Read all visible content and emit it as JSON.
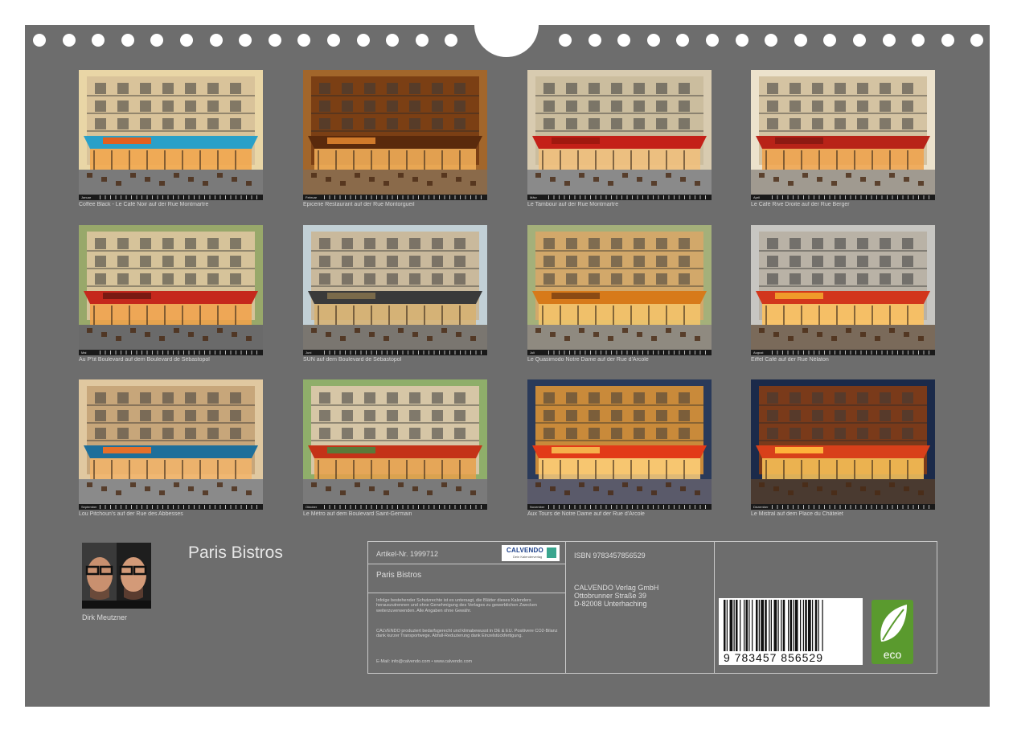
{
  "calendar": {
    "title": "Paris Bistros",
    "author": "Dirk Meutzner"
  },
  "months": [
    {
      "month": "Januar",
      "caption": "Coffee Black - Le Café Noir auf der Rue Montmartre",
      "scene": "noir"
    },
    {
      "month": "Februar",
      "caption": "Epicerie Restaurant auf der Rue Montorgueil",
      "scene": "epicerie"
    },
    {
      "month": "März",
      "caption": "Le Tambour auf der Rue Montmartre",
      "scene": "tambour"
    },
    {
      "month": "April",
      "caption": "Le Café Rive Droite auf der Rue Berger",
      "scene": "rivedroite"
    },
    {
      "month": "Mai",
      "caption": "Au P'tit Boulevard auf dem Boulevard de Sébastopol",
      "scene": "ptit"
    },
    {
      "month": "Juni",
      "caption": "SUN auf dem Boulevard de Sébastopol",
      "scene": "sun"
    },
    {
      "month": "Juli",
      "caption": "Le Quasimodo Notre Dame auf der Rue d'Arcole",
      "scene": "quasimodo"
    },
    {
      "month": "August",
      "caption": "Eiffel Café auf der Rue Nélaton",
      "scene": "eiffel"
    },
    {
      "month": "September",
      "caption": "Lou Pitchoun's auf der Rue des Abbesses",
      "scene": "pitchoun"
    },
    {
      "month": "Oktober",
      "caption": "Le Métro auf dem Boulevard Saint-Germain",
      "scene": "metro"
    },
    {
      "month": "November",
      "caption": "Aux Tours de Notre Dame auf der Rue d'Arcole",
      "scene": "tours"
    },
    {
      "month": "Dezember",
      "caption": "Le Mistral auf dem Place du Châtelet",
      "scene": "mistral"
    }
  ],
  "info": {
    "article": "Artikel-Nr. 1999712",
    "logo_word": "CALVENDO",
    "logo_sub": "Dein Kalenderverlag",
    "title": "Paris Bistros",
    "legal_1": "Infolge bestehender Schutzrechte ist es untersagt, die Blätter dieses Kalenders herauszutrennen und ohne Genehmigung des Verlages zu gewerblichen Zwecken weiterzuverwenden. Alle Angaben ohne Gewähr.",
    "legal_2": "CALVENDO produziert bedarfsgerecht und klimabewusst in DE & EU. Positivere CO2-Bilanz dank kurzer Transportwege. Abfall-Reduzierung dank Einzelstückfertigung.",
    "contact": "E-Mail: info@calvendo.com • www.calvendo.com",
    "isbn": "ISBN 9783457856529",
    "publisher": "CALVENDO Verlag GmbH",
    "street": "Ottobrunner Straße 39",
    "city": "D-82008 Unterhaching",
    "barcode_digits": "9 783457 856529",
    "eco_label": "eco"
  },
  "colors": {
    "sheet": "#6d6d6d",
    "border": "#c9c9c9",
    "eco_green": "#5a9a2e"
  }
}
